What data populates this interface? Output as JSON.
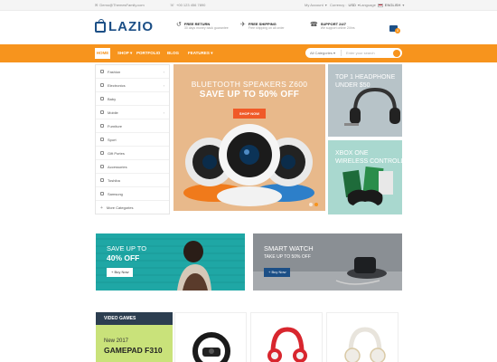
{
  "topbar": {
    "email": "Demo@ThemesFamily.com",
    "phone": "+00 123 456 7890",
    "account": "My Account",
    "currency_label": "Currency :",
    "currency_value": "USD",
    "language_label": "Language",
    "language_value": "ENGLISH"
  },
  "header": {
    "logo": "LAZIO",
    "features": [
      {
        "title": "FREE RETURN",
        "sub": "30 days money back guarantee",
        "icon": "return-icon"
      },
      {
        "title": "FREE SHIPPING",
        "sub": "Free shipping on all order",
        "icon": "shipping-icon"
      },
      {
        "title": "SUPPORT 24/7",
        "sub": "We support online 24hrs",
        "icon": "support-icon"
      }
    ],
    "cart_count": "0"
  },
  "nav": {
    "items": [
      "HOME",
      "SHOP",
      "PORTFOLIO",
      "BLOG",
      "FEATURES"
    ],
    "search_category": "All Categories",
    "search_placeholder": "Enter your search"
  },
  "categories": [
    {
      "label": "Fashion",
      "has_sub": true
    },
    {
      "label": "Electronics",
      "has_sub": true
    },
    {
      "label": "Baby",
      "has_sub": false
    },
    {
      "label": "Mobile",
      "has_sub": true
    },
    {
      "label": "Furniture",
      "has_sub": false
    },
    {
      "label": "Sport",
      "has_sub": false
    },
    {
      "label": "Gift Portes",
      "has_sub": false
    },
    {
      "label": "Accessories",
      "has_sub": false
    },
    {
      "label": "Toshiba",
      "has_sub": false
    },
    {
      "label": "Samsung",
      "has_sub": false
    },
    {
      "label": "More Categories",
      "has_sub": false
    }
  ],
  "hero": {
    "line1": "BLUETOOTH SPEAKERS Z600",
    "line2": "SAVE UP TO 50% OFF",
    "button": "SHOP NOW",
    "slide_count": 2,
    "active_slide": 1
  },
  "side_banners": [
    {
      "line1": "TOP 1 HEADPHONE",
      "line2": "UNDER $50"
    },
    {
      "line1": "XBOX ONE",
      "line2": "WIRELESS CONTROLLER"
    }
  ],
  "promos": [
    {
      "line1": "SAVE UP TO",
      "line2": "40% OFF",
      "button": "+ Buy Now"
    },
    {
      "line1": "SMART WATCH",
      "line2": "TAKE UP TO 50% OFF",
      "button": "+ Buy Now"
    }
  ],
  "video_games": {
    "heading": "VIDEO GAMES",
    "line1": "New 2017",
    "line2": "GAMEPAD F310"
  },
  "colors": {
    "accent": "#f7941d",
    "brand": "#1c4f86",
    "hero_bg": "#e8b98b",
    "promo1_bg": "#1fa7a5",
    "vg_bg": "#c9e27a"
  }
}
